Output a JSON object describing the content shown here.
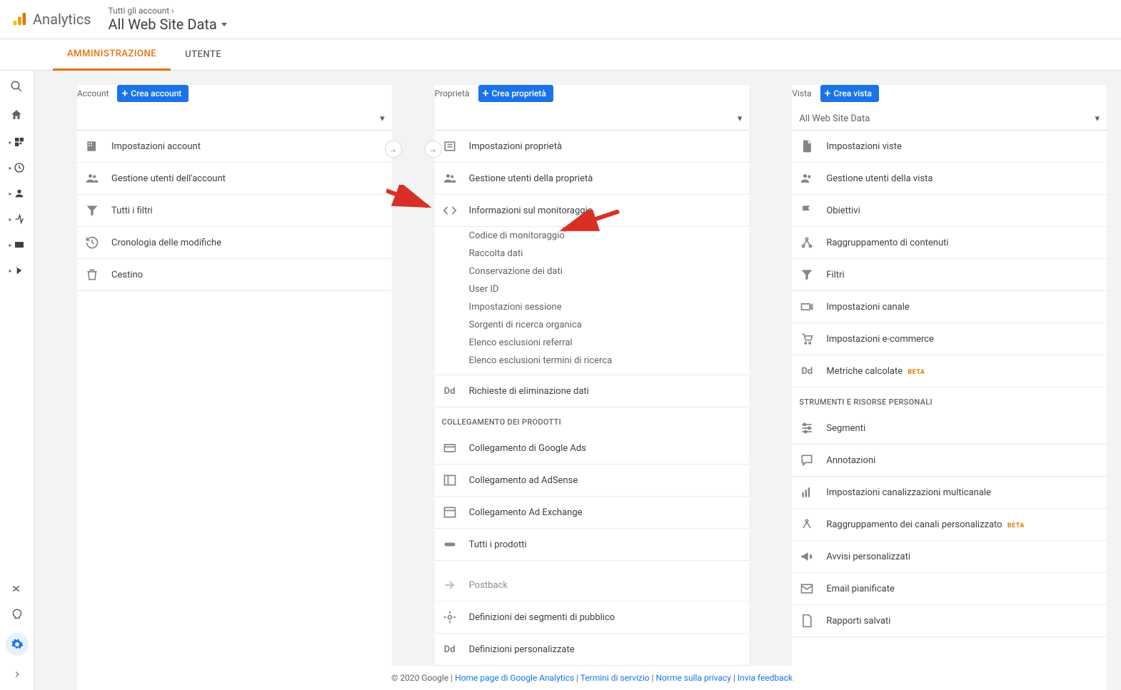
{
  "header": {
    "logo_text": "Analytics",
    "breadcrumb_top": "Tutti gli account ›",
    "breadcrumb_main": "All Web Site Data"
  },
  "tabs": {
    "admin": "AMMINISTRAZIONE",
    "user": "UTENTE"
  },
  "columns": {
    "account": {
      "label": "Account",
      "create_btn": "Crea account",
      "items": {
        "settings": "Impostazioni account",
        "users": "Gestione utenti dell'account",
        "filters": "Tutti i filtri",
        "history": "Cronologia delle modifiche",
        "trash": "Cestino"
      }
    },
    "property": {
      "label": "Proprietà",
      "create_btn": "Crea proprietà",
      "items": {
        "settings": "Impostazioni proprietà",
        "users": "Gestione utenti della proprietà",
        "tracking": "Informazioni sul monitoraggio",
        "dd_requests": "Richieste di eliminazione dati"
      },
      "tracking_sub": {
        "code": "Codice di monitoraggio",
        "data_collection": "Raccolta dati",
        "retention": "Conservazione dei dati",
        "userid": "User ID",
        "session": "Impostazioni sessione",
        "organic": "Sorgenti di ricerca organica",
        "referral": "Elenco esclusioni referral",
        "search_terms": "Elenco esclusioni termini di ricerca"
      },
      "product_linking_header": "COLLEGAMENTO DEI PRODOTTI",
      "products": {
        "ads": "Collegamento di Google Ads",
        "adsense": "Collegamento ad AdSense",
        "adexchange": "Collegamento Ad Exchange",
        "all": "Tutti i prodotti"
      },
      "postback": "Postback",
      "audience": "Definizioni dei segmenti di pubblico",
      "custom_defs": "Definizioni personalizzate"
    },
    "view": {
      "label": "Vista",
      "create_btn": "Crea vista",
      "selector": "All Web Site Data",
      "items": {
        "settings": "Impostazioni viste",
        "users": "Gestione utenti della vista",
        "goals": "Obiettivi",
        "content_grouping": "Raggruppamento di contenuti",
        "filters": "Filtri",
        "channel_settings": "Impostazioni canale",
        "ecommerce": "Impostazioni e-commerce",
        "calculated_metrics": "Metriche calcolate"
      },
      "beta": "BETA",
      "personal_tools_header": "STRUMENTI E RISORSE PERSONALI",
      "personal": {
        "segments": "Segmenti",
        "annotations": "Annotazioni",
        "multichannel": "Impostazioni canalizzazioni multicanale",
        "custom_channel": "Raggruppamento dei canali personalizzato",
        "custom_alerts": "Avvisi personalizzati",
        "scheduled_emails": "Email pianificate",
        "saved_reports": "Rapporti salvati"
      }
    }
  },
  "footer": {
    "copyright": "© 2020 Google",
    "home": "Home page di Google Analytics",
    "terms": "Termini di servizio",
    "privacy": "Norme sulla privacy",
    "feedback": "Invia feedback"
  }
}
